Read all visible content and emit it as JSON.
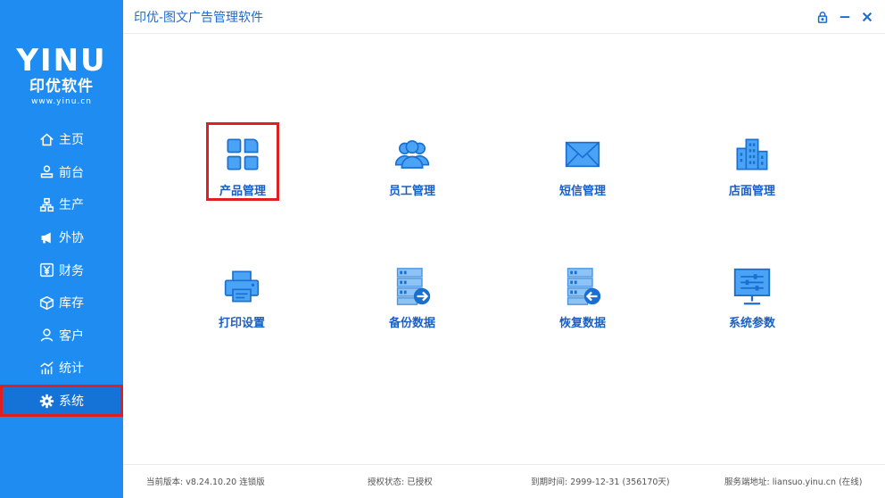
{
  "app": {
    "title": "印优-图文广告管理软件",
    "brand_color": "#1e8cf0"
  },
  "logo": {
    "wordmark": "YINU",
    "name": "印优软件",
    "url": "www.yinu.cn"
  },
  "sidebar": {
    "items": [
      {
        "label": "主页",
        "icon": "home-icon"
      },
      {
        "label": "前台",
        "icon": "front-desk-icon"
      },
      {
        "label": "生产",
        "icon": "production-icon"
      },
      {
        "label": "外协",
        "icon": "megaphone-icon"
      },
      {
        "label": "财务",
        "icon": "yen-icon"
      },
      {
        "label": "库存",
        "icon": "box-icon"
      },
      {
        "label": "客户",
        "icon": "user-icon"
      },
      {
        "label": "统计",
        "icon": "chart-icon"
      },
      {
        "label": "系统",
        "icon": "gear-icon",
        "active": true
      }
    ]
  },
  "tiles": [
    {
      "label": "产品管理",
      "icon": "grid-icon",
      "selected": true
    },
    {
      "label": "员工管理",
      "icon": "staff-icon"
    },
    {
      "label": "短信管理",
      "icon": "envelope-icon"
    },
    {
      "label": "店面管理",
      "icon": "building-icon"
    },
    {
      "label": "打印设置",
      "icon": "printer-icon"
    },
    {
      "label": "备份数据",
      "icon": "backup-icon"
    },
    {
      "label": "恢复数据",
      "icon": "restore-icon"
    },
    {
      "label": "系统参数",
      "icon": "settings-monitor-icon"
    }
  ],
  "status": {
    "version": "当前版本: v8.24.10.20  连锁版",
    "license": "授权状态: 已授权",
    "expiry": "到期时间: 2999-12-31 (356170天)",
    "server": "服务端地址: liansuo.yinu.cn (在线)"
  }
}
